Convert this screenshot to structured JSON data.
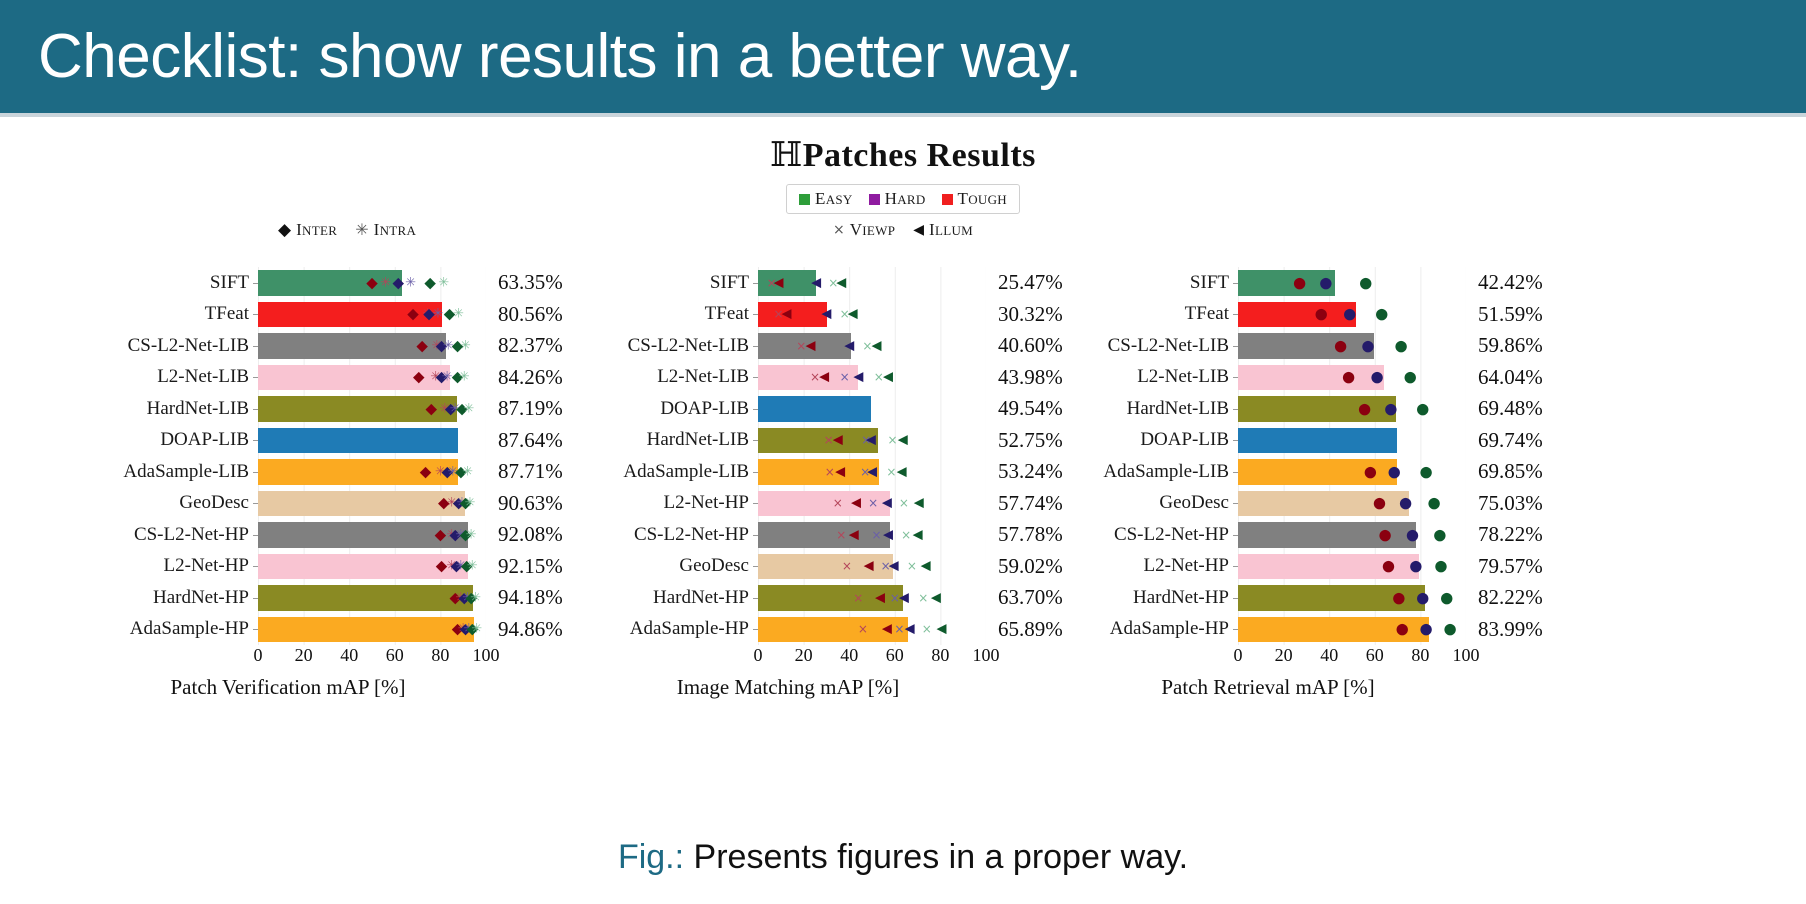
{
  "slide": {
    "title": "Checklist: show results in a better way.",
    "header_bg": "#1d6a84",
    "caption_label": "Fig.:",
    "caption_text": "Presents figures in a proper way.",
    "caption_label_color": "#1d6a84"
  },
  "figure": {
    "title_prefix": "ℍ",
    "title": "Patches Results",
    "legend_difficulty": {
      "items": [
        {
          "label": "Easy",
          "color": "#2e9e3a",
          "icon": "square-swatch"
        },
        {
          "label": "Hard",
          "color": "#8f1ba0",
          "icon": "square-swatch"
        },
        {
          "label": "Tough",
          "color": "#f01f1f",
          "icon": "square-swatch"
        }
      ]
    },
    "legend_scene": {
      "items": [
        {
          "label": "Viewp",
          "glyph": "×",
          "icon": "cross-marker-icon"
        },
        {
          "label": "Illum",
          "glyph": "◀",
          "icon": "left-triangle-marker-icon"
        }
      ]
    },
    "legend_interintra": {
      "items": [
        {
          "label": "Inter",
          "glyph": "♦",
          "icon": "diamond-marker-icon"
        },
        {
          "label": "Intra",
          "glyph": "✳",
          "icon": "star-marker-icon"
        }
      ]
    }
  },
  "method_colors": {
    "SIFT": "#3f9168",
    "TFeat": "#f41e1e",
    "CS-L2-Net-LIB": "#808080",
    "L2-Net-LIB": "#f9c4d2",
    "HardNet-LIB": "#8a8a23",
    "DOAP-LIB": "#1f7bb6",
    "AdaSample-LIB": "#fbaa21",
    "GeoDesc": "#e7c9a3",
    "CS-L2-Net-HP": "#808080",
    "L2-Net-HP": "#f9c4d2",
    "HardNet-HP": "#8a8a23",
    "AdaSample-HP": "#fbaa21"
  },
  "chart_data": [
    {
      "type": "bar",
      "id": "patch-verification",
      "title": "",
      "xlabel": "Patch Verification mAP [%]",
      "ylabel": "",
      "xlim": [
        0,
        100
      ],
      "xticks": [
        0,
        20,
        40,
        60,
        80,
        100
      ],
      "grid": true,
      "orientation": "horizontal",
      "categories": [
        "SIFT",
        "TFeat",
        "CS-L2-Net-LIB",
        "L2-Net-LIB",
        "HardNet-LIB",
        "DOAP-LIB",
        "AdaSample-LIB",
        "GeoDesc",
        "CS-L2-Net-HP",
        "L2-Net-HP",
        "HardNet-HP",
        "AdaSample-HP"
      ],
      "values": [
        63.35,
        80.56,
        82.37,
        84.26,
        87.19,
        87.64,
        87.71,
        90.63,
        92.08,
        92.15,
        94.18,
        94.86
      ],
      "value_labels": [
        "63.35%",
        "80.56%",
        "82.37%",
        "84.26%",
        "87.19%",
        "87.64%",
        "87.71%",
        "90.63%",
        "92.08%",
        "92.15%",
        "94.18%",
        "94.86%"
      ],
      "markers": {
        "tough_inter": [
          50.0,
          68.0,
          72.0,
          70.5,
          76.0,
          null,
          73.5,
          81.5,
          80.0,
          80.5,
          86.5,
          87.5
        ],
        "tough_intra": [
          56.0,
          74.5,
          78.5,
          78.0,
          82.0,
          null,
          80.0,
          85.0,
          85.0,
          85.0,
          89.0,
          90.0
        ],
        "hard_inter": [
          61.5,
          75.0,
          80.5,
          80.5,
          84.5,
          null,
          83.0,
          88.0,
          86.5,
          87.0,
          90.5,
          91.0
        ],
        "hard_intra": [
          67.0,
          79.0,
          83.5,
          83.0,
          86.5,
          null,
          85.5,
          89.5,
          89.0,
          89.0,
          92.0,
          92.5
        ],
        "easy_inter": [
          75.5,
          84.0,
          87.5,
          87.5,
          89.5,
          null,
          89.0,
          91.0,
          91.0,
          91.5,
          93.5,
          94.0
        ],
        "easy_intra": [
          81.5,
          88.0,
          91.0,
          90.5,
          92.5,
          null,
          92.0,
          93.0,
          93.5,
          94.0,
          95.5,
          96.0
        ]
      }
    },
    {
      "type": "bar",
      "id": "image-matching",
      "title": "",
      "xlabel": "Image Matching mAP [%]",
      "ylabel": "",
      "xlim": [
        0,
        100
      ],
      "xticks": [
        0,
        20,
        40,
        60,
        80,
        100
      ],
      "grid": true,
      "orientation": "horizontal",
      "categories": [
        "SIFT",
        "TFeat",
        "CS-L2-Net-LIB",
        "L2-Net-LIB",
        "DOAP-LIB",
        "HardNet-LIB",
        "AdaSample-LIB",
        "L2-Net-HP",
        "CS-L2-Net-HP",
        "GeoDesc",
        "HardNet-HP",
        "AdaSample-HP"
      ],
      "values": [
        25.47,
        30.32,
        40.6,
        43.98,
        49.54,
        52.75,
        53.24,
        57.74,
        57.78,
        59.02,
        63.7,
        65.89
      ],
      "value_labels": [
        "25.47%",
        "30.32%",
        "40.60%",
        "43.98%",
        "49.54%",
        "52.75%",
        "53.24%",
        "57.74%",
        "57.78%",
        "59.02%",
        "63.70%",
        "65.89%"
      ],
      "markers": {
        "tough_viewp": [
          6.0,
          9.0,
          19.0,
          25.0,
          null,
          31.0,
          31.5,
          35.0,
          36.5,
          39.0,
          44.0,
          46.0
        ],
        "tough_illum": [
          9.0,
          12.5,
          23.0,
          29.0,
          null,
          35.0,
          36.0,
          43.0,
          42.0,
          48.5,
          53.5,
          56.5
        ],
        "hard_viewp": [
          null,
          null,
          null,
          38.0,
          null,
          47.5,
          47.0,
          50.5,
          52.0,
          56.0,
          60.0,
          62.0
        ],
        "hard_illum": [
          25.5,
          30.0,
          40.0,
          44.0,
          null,
          49.5,
          50.0,
          56.5,
          57.0,
          59.5,
          64.0,
          66.5
        ],
        "easy_viewp": [
          33.0,
          38.0,
          48.0,
          53.0,
          null,
          59.0,
          58.5,
          64.0,
          65.0,
          67.5,
          72.5,
          74.0
        ],
        "easy_illum": [
          36.5,
          41.5,
          52.0,
          57.0,
          null,
          63.5,
          63.0,
          70.5,
          70.0,
          73.5,
          78.0,
          80.5
        ]
      }
    },
    {
      "type": "bar",
      "id": "patch-retrieval",
      "title": "",
      "xlabel": "Patch Retrieval mAP [%]",
      "ylabel": "",
      "xlim": [
        0,
        100
      ],
      "xticks": [
        0,
        20,
        40,
        60,
        80,
        100
      ],
      "grid": true,
      "orientation": "horizontal",
      "categories": [
        "SIFT",
        "TFeat",
        "CS-L2-Net-LIB",
        "L2-Net-LIB",
        "HardNet-LIB",
        "DOAP-LIB",
        "AdaSample-LIB",
        "GeoDesc",
        "CS-L2-Net-HP",
        "L2-Net-HP",
        "HardNet-HP",
        "AdaSample-HP"
      ],
      "values": [
        42.42,
        51.59,
        59.86,
        64.04,
        69.48,
        69.74,
        69.85,
        75.03,
        78.22,
        79.57,
        82.22,
        83.99
      ],
      "value_labels": [
        "42.42%",
        "51.59%",
        "59.86%",
        "64.04%",
        "69.48%",
        "69.74%",
        "69.85%",
        "75.03%",
        "78.22%",
        "79.57%",
        "82.22%",
        "83.99%"
      ],
      "markers": {
        "tough": [
          27.0,
          36.5,
          45.0,
          48.5,
          55.5,
          null,
          58.0,
          62.0,
          64.5,
          66.0,
          70.5,
          72.0
        ],
        "hard": [
          38.5,
          49.0,
          57.0,
          61.0,
          67.0,
          null,
          68.5,
          73.5,
          76.5,
          78.0,
          81.0,
          82.5
        ],
        "easy": [
          56.0,
          63.0,
          71.5,
          75.5,
          81.0,
          null,
          82.5,
          86.0,
          88.5,
          89.0,
          91.5,
          93.0
        ]
      }
    }
  ],
  "marker_colors": {
    "tough_inter": "#8b0010",
    "tough_intra": "#b4455a",
    "hard_inter": "#241b6a",
    "hard_intra": "#6a5fa8",
    "easy_inter": "#0e5a2c",
    "easy_intra": "#7fbf9a"
  }
}
